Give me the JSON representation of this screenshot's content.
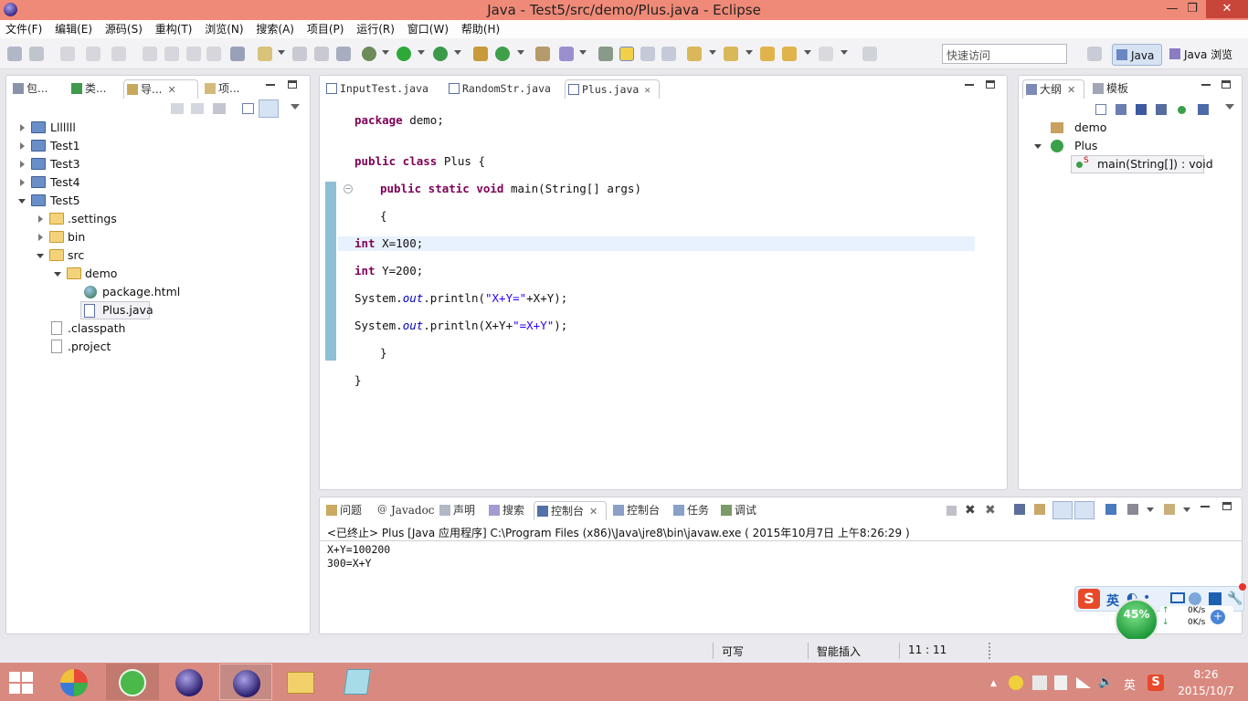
{
  "window": {
    "title": "Java  -  Test5/src/demo/Plus.java  -  Eclipse",
    "minimize": "—",
    "maximize": "❐",
    "close": "✕"
  },
  "menu": [
    "文件(F)",
    "编辑(E)",
    "源码(S)",
    "重构(T)",
    "浏览(N)",
    "搜索(A)",
    "项目(P)",
    "运行(R)",
    "窗口(W)",
    "帮助(H)"
  ],
  "toolbar": {
    "quick_access_placeholder": "快速访问",
    "perspective_java": "Java",
    "perspective_browse": "Java 浏览"
  },
  "left_panel": {
    "tabs": [
      "包...",
      "类...",
      "导...",
      "项..."
    ],
    "tree": [
      {
        "label": "Lllllll",
        "level": 0,
        "type": "project",
        "state": "closed"
      },
      {
        "label": "Test1",
        "level": 0,
        "type": "project",
        "state": "closed"
      },
      {
        "label": "Test3",
        "level": 0,
        "type": "project",
        "state": "closed"
      },
      {
        "label": "Test4",
        "level": 0,
        "type": "project",
        "state": "closed"
      },
      {
        "label": "Test5",
        "level": 0,
        "type": "project",
        "state": "open"
      },
      {
        "label": ".settings",
        "level": 1,
        "type": "folder",
        "state": "closed"
      },
      {
        "label": "bin",
        "level": 1,
        "type": "folder",
        "state": "closed"
      },
      {
        "label": "src",
        "level": 1,
        "type": "folder",
        "state": "open"
      },
      {
        "label": "demo",
        "level": 2,
        "type": "folder",
        "state": "open"
      },
      {
        "label": "package.html",
        "level": 3,
        "type": "html",
        "state": "none"
      },
      {
        "label": "Plus.java",
        "level": 3,
        "type": "java",
        "state": "none"
      },
      {
        "label": ".classpath",
        "level": 1,
        "type": "file",
        "state": "none"
      },
      {
        "label": ".project",
        "level": 1,
        "type": "file",
        "state": "none"
      }
    ]
  },
  "editor": {
    "tabs": [
      "InputTest.java",
      "RandomStr.java",
      "Plus.java"
    ],
    "code": {
      "l1_kw": "package",
      "l1_rest": " demo;",
      "l2_kw": "public class",
      "l2_rest": " Plus {",
      "l3_kw": "public static void",
      "l3_rest": " main(String[] args)",
      "l4": "{",
      "l5_kw": "int",
      "l5_rest": " X=100;",
      "l6_kw": "int",
      "l6_rest": " Y=200;",
      "l7_a": "System.",
      "l7_b": "out",
      "l7_c": ".println(",
      "l7_d": "\"X+Y=\"",
      "l7_e": "+X+Y);",
      "l8_a": "System.",
      "l8_b": "out",
      "l8_c": ".println(X+Y+",
      "l8_d": "\"=X+Y\"",
      "l8_e": ");",
      "l9": "}",
      "l10": "}"
    }
  },
  "outline": {
    "tabs": [
      "大纲",
      "模板"
    ],
    "items": [
      "demo",
      "Plus",
      "main(String[]) : void"
    ],
    "static_marker": "S"
  },
  "console": {
    "tabs": [
      "问题",
      "Javadoc",
      "声明",
      "搜索",
      "控制台",
      "控制台",
      "任务",
      "调试"
    ],
    "header": "<已终止> Plus [Java 应用程序] C:\\Program Files (x86)\\Java\\jre8\\bin\\javaw.exe ( 2015年10月7日 上午8:26:29 )",
    "output": [
      "X+Y=100200",
      "300=X+Y"
    ]
  },
  "overlay": {
    "ime_label": "英",
    "speed_percent": "45%",
    "up_speed": "0K/s",
    "down_speed": "0K/s"
  },
  "status": {
    "writable": "可写",
    "insert_mode": "智能插入",
    "position": "11 : 11"
  },
  "taskbar": {
    "time": "8:26",
    "date": "2015/10/7",
    "ime": "英"
  }
}
